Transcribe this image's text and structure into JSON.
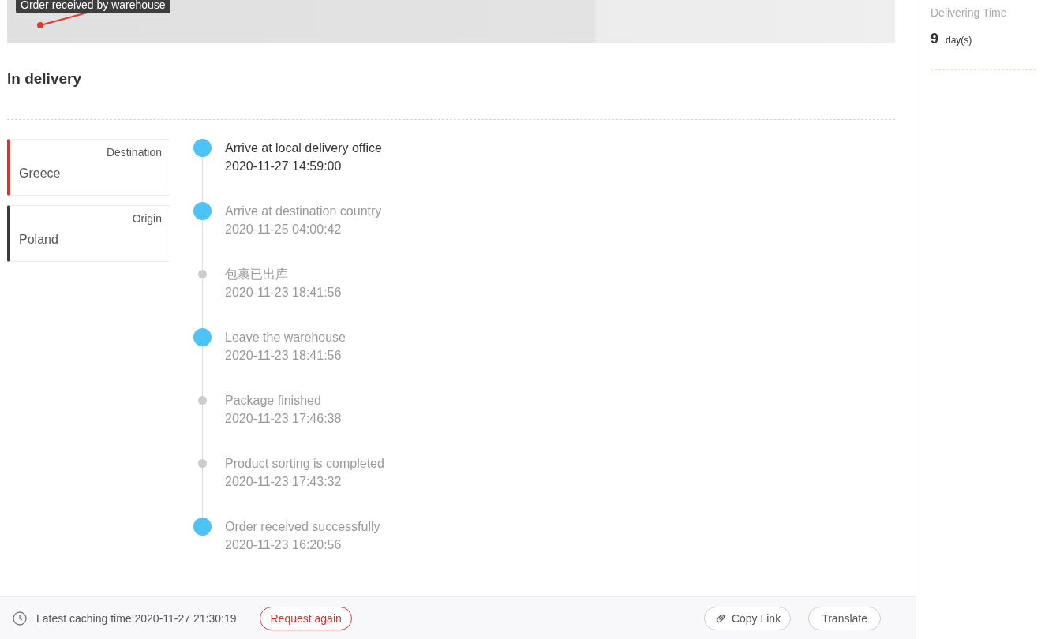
{
  "map": {
    "tooltip": "Order received by warehouse"
  },
  "status": {
    "title": "In delivery"
  },
  "locations": [
    {
      "label": "Destination",
      "value": "Greece",
      "color": "#d9342b"
    },
    {
      "label": "Origin",
      "value": "Poland",
      "color": "#3a3a3a"
    }
  ],
  "events": [
    {
      "kind": "major",
      "current": true,
      "title": "Arrive at local delivery office",
      "time": "2020-11-27 14:59:00"
    },
    {
      "kind": "major",
      "current": false,
      "title": "Arrive at destination country",
      "time": "2020-11-25 04:00:42"
    },
    {
      "kind": "minor",
      "current": false,
      "title": "包裹已出库",
      "time": "2020-11-23 18:41:56"
    },
    {
      "kind": "major",
      "current": false,
      "title": "Leave the warehouse",
      "time": "2020-11-23 18:41:56"
    },
    {
      "kind": "minor",
      "current": false,
      "title": "Package finished",
      "time": "2020-11-23 17:46:38"
    },
    {
      "kind": "minor",
      "current": false,
      "title": "Product sorting is completed",
      "time": "2020-11-23 17:43:32"
    },
    {
      "kind": "major",
      "current": false,
      "title": "Order received successfully",
      "time": "2020-11-23 16:20:56"
    }
  ],
  "footer": {
    "caching": "Latest caching time:2020-11-27 21:30:19",
    "request_button": "Request again",
    "copy_button": "Copy Link",
    "translate_button": "Translate"
  },
  "sidebar": {
    "label": "Delivering Time",
    "value": "9",
    "unit": "day(s)"
  }
}
